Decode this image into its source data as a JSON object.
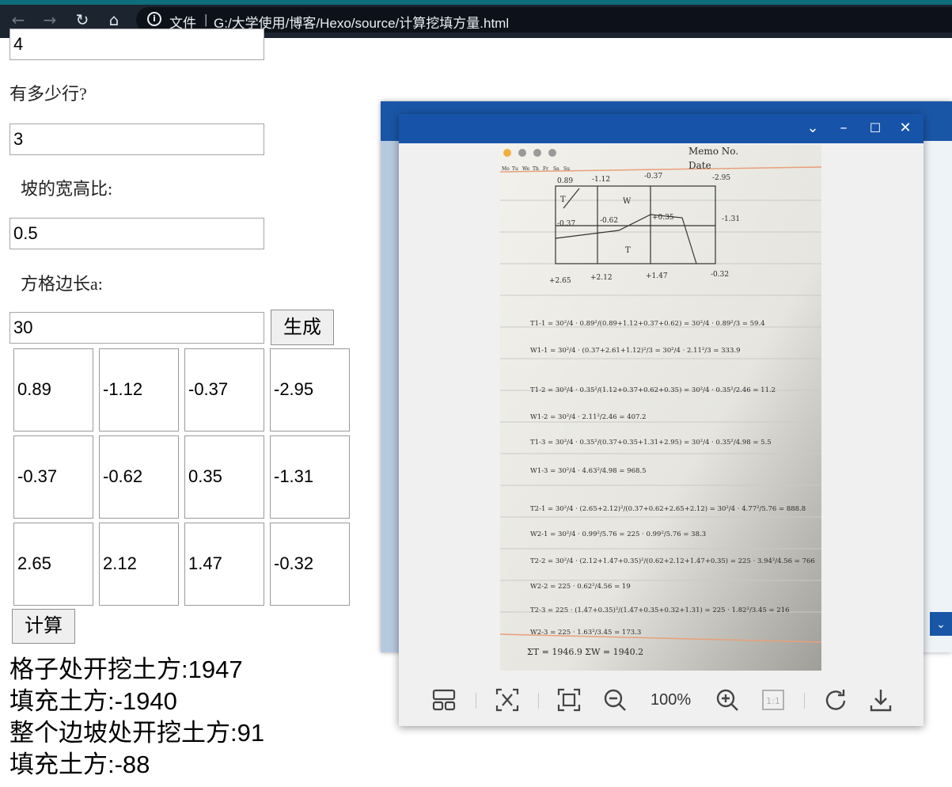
{
  "browser": {
    "file_label": "文件",
    "separator": "|",
    "url": "G:/大学使用/博客/Hexo/source/计算挖填方量.html"
  },
  "form": {
    "cols_value": "4",
    "rows_question": "有多少行?",
    "rows_value": "3",
    "slope_question": "坡的宽高比:",
    "slope_value": "0.5",
    "side_question": "方格边长a:",
    "side_value": "30",
    "generate_label": "生成",
    "grid": [
      [
        "0.89",
        "-1.12",
        "-0.37",
        "-2.95"
      ],
      [
        "-0.37",
        "-0.62",
        "0.35",
        "-1.31"
      ],
      [
        "2.65",
        "2.12",
        "1.47",
        "-0.32"
      ]
    ],
    "calc_label": "计算"
  },
  "results": [
    "格子处开挖土方:1947",
    "填充土方:-1940",
    "整个边坡处开挖土方:91",
    "填充土方:-88"
  ],
  "viewer": {
    "zoom": "100%",
    "actual_size_label": "1:1",
    "paper_header": {
      "memo": "Memo No.",
      "date": "Date"
    },
    "weekdays": [
      "Mo",
      "Tu",
      "We",
      "Th",
      "Fr",
      "Sa",
      "Su"
    ],
    "sketch": {
      "top_values": [
        "0.89",
        "-1.12",
        "-0.37",
        "-2.95"
      ],
      "mid_left": "-0.37",
      "mid_values": [
        "-0.62",
        "+0.35",
        "-1.31"
      ],
      "bottom_values": [
        "+2.65",
        "+2.12",
        "+1.47",
        "-0.32"
      ],
      "zone_labels": [
        "T",
        "W",
        "T"
      ]
    },
    "equations": [
      "T1-1 = 30²/4 · 0.89²/(0.89+1.12+0.37+0.62) = 30²/4 · 0.89²/3 = 59.4",
      "W1-1 = 30²/4 · (0.37+2.61+1.12)²/3 = 30²/4 · 2.11²/3 = 333.9",
      "T1-2 = 30²/4 · 0.35²/(1.12+0.37+0.62+0.35) = 30²/4 · 0.35²/2.46 = 11.2",
      "W1-2 = 30²/4 · 2.11²/2.46 = 407.2",
      "T1-3 = 30²/4 · 0.35²/(0.37+0.35+1.31+2.95) = 30²/4 · 0.35²/4.98 = 5.5",
      "W1-3 = 30²/4 · 4.63²/4.98 = 968.5",
      "T2-1 = 30²/4 · (2.65+2.12)²/(0.37+0.62+2.65+2.12) = 30²/4 · 4.77²/5.76 = 888.8",
      "W2-1 = 30²/4 · 0.99²/5.76 = 225 · 0.99²/5.76 = 38.3",
      "T2-2 = 30²/4 · (2.12+1.47+0.35)²/(0.62+2.12+1.47+0.35) = 225 · 3.94²/4.56 = 766",
      "W2-2 = 225 · 0.62²/4.56 = 19",
      "T2-3 = 225 · (1.47+0.35)²/(1.47+0.35+0.32+1.31) = 225 · 1.82²/3.45 = 216",
      "W2-3 = 225 · 1.63²/3.45 = 173.3",
      "ΣT = 1946.9    ΣW = 1940.2"
    ]
  }
}
